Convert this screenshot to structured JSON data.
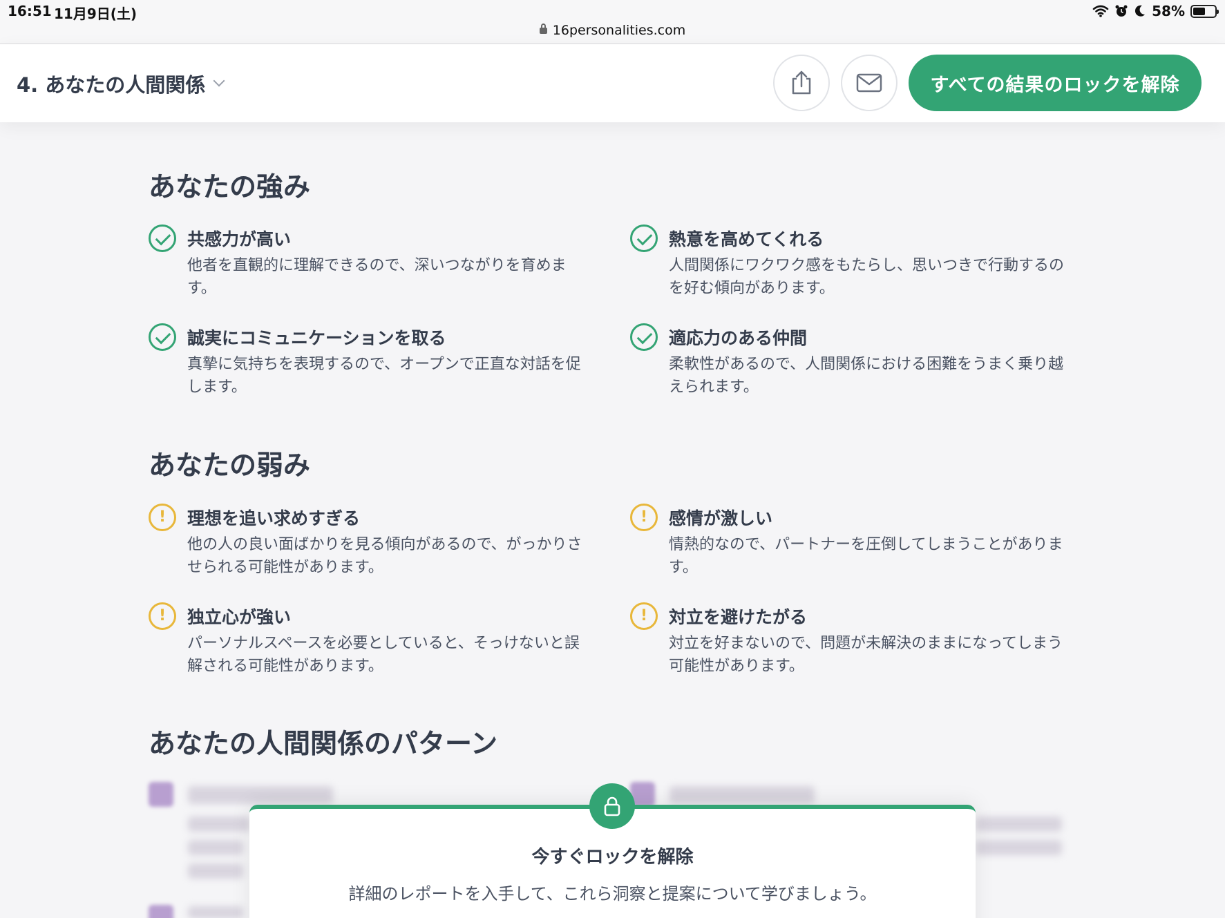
{
  "status_bar": {
    "time": "16:51",
    "date": "11月9日(土)",
    "url": "16personalities.com",
    "battery": "58%",
    "battery_level": 0.58
  },
  "header": {
    "section_label": "4. あなたの人間関係",
    "unlock_button": "すべての結果のロックを解除"
  },
  "strengths": {
    "title": "あなたの強み",
    "items": [
      {
        "title": "共感力が高い",
        "desc": "他者を直観的に理解できるので、深いつながりを育めます。"
      },
      {
        "title": "熱意を高めてくれる",
        "desc": "人間関係にワクワク感をもたらし、思いつきで行動するのを好む傾向があります。"
      },
      {
        "title": "誠実にコミュニケーションを取る",
        "desc": "真摯に気持ちを表現するので、オープンで正直な対話を促します。"
      },
      {
        "title": "適応力のある仲間",
        "desc": "柔軟性があるので、人間関係における困難をうまく乗り越えられます。"
      }
    ]
  },
  "weaknesses": {
    "title": "あなたの弱み",
    "items": [
      {
        "title": "理想を追い求めすぎる",
        "desc": "他の人の良い面ばかりを見る傾向があるので、がっかりさせられる可能性があります。"
      },
      {
        "title": "感情が激しい",
        "desc": "情熱的なので、パートナーを圧倒してしまうことがあります。"
      },
      {
        "title": "独立心が強い",
        "desc": "パーソナルスペースを必要としていると、そっけないと誤解される可能性があります。"
      },
      {
        "title": "対立を避けたがる",
        "desc": "対立を好まないので、問題が未解決のままになってしまう可能性があります。"
      }
    ]
  },
  "patterns": {
    "title": "あなたの人間関係のパターン"
  },
  "unlock_card": {
    "title": "今すぐロックを解除",
    "desc": "詳細のレポートを入手して、これら洞察と提案について学びましょう。"
  },
  "colors": {
    "accent": "#33a474",
    "warning": "#e8b73a",
    "text": "#343c4b",
    "background": "#f5f5f7"
  }
}
